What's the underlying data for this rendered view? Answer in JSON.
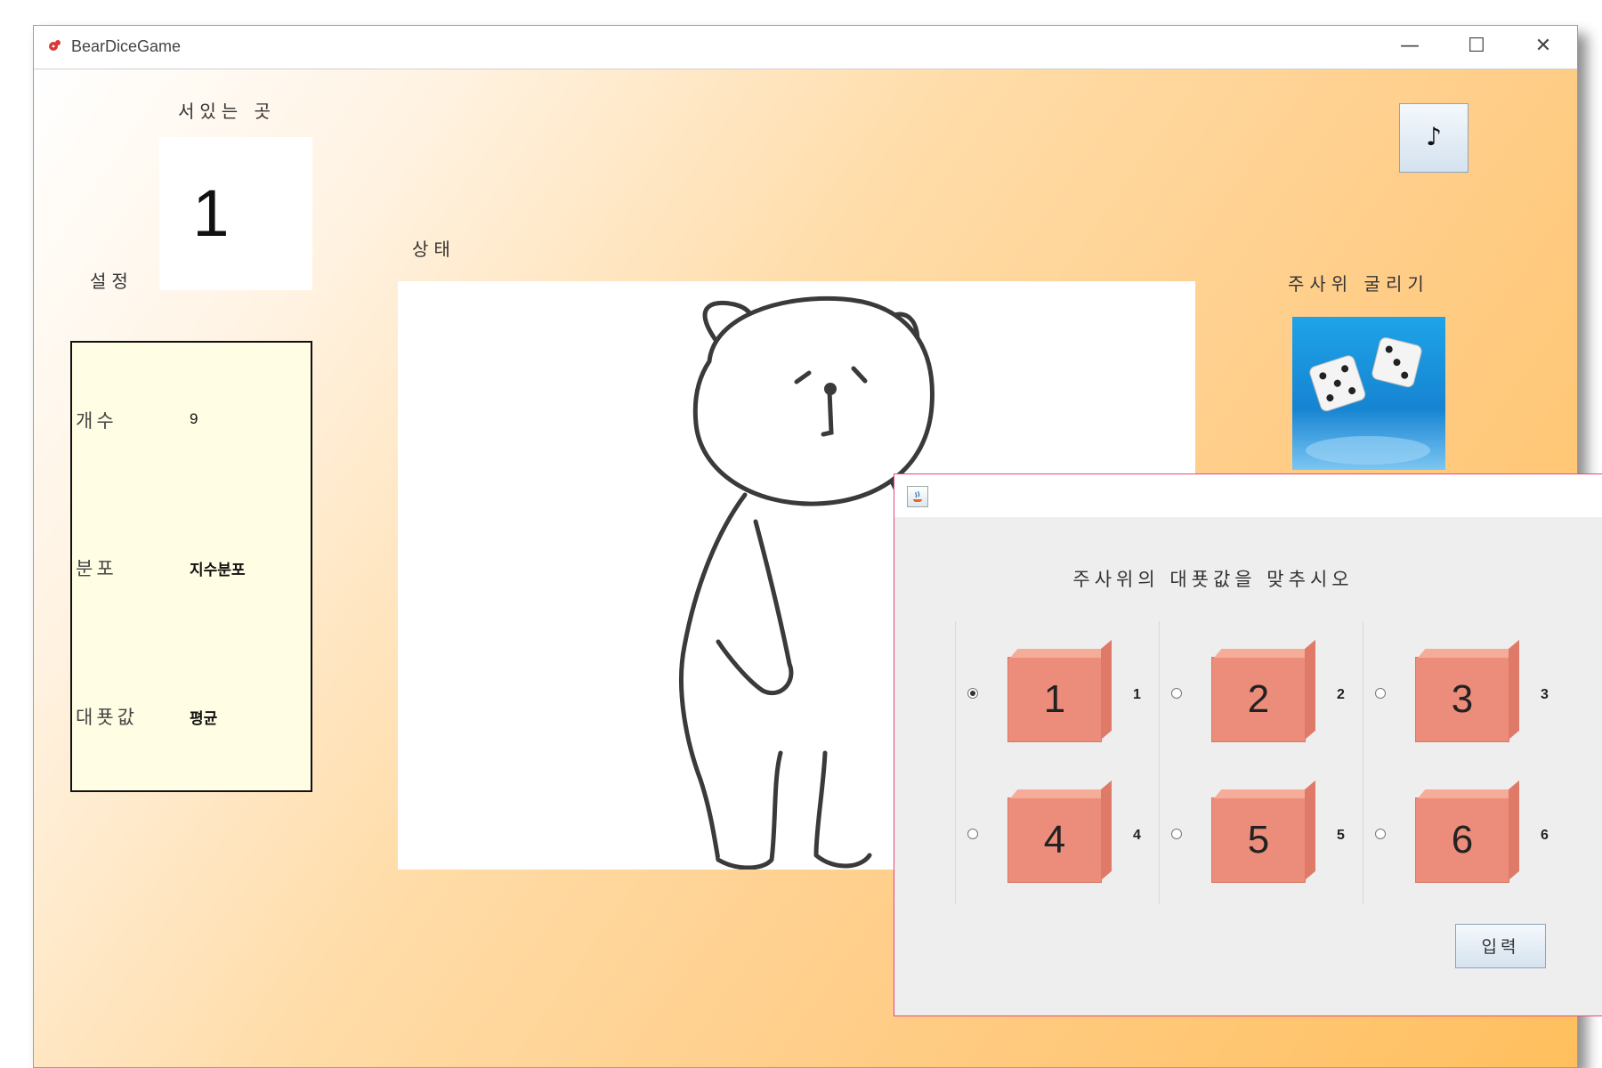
{
  "window": {
    "title": "BearDiceGame",
    "minimize_glyph": "—",
    "maximize_glyph": "☐",
    "close_glyph": "✕"
  },
  "position": {
    "label": "서있는 곳",
    "value": "1"
  },
  "settings": {
    "label": "설정",
    "rows": [
      {
        "key": "개수",
        "value": "9"
      },
      {
        "key": "분포",
        "value": "지수분포"
      },
      {
        "key": "대푯값",
        "value": "평균"
      }
    ]
  },
  "status": {
    "label": "상태"
  },
  "music_button": {
    "label": "♪"
  },
  "roll": {
    "label": "주사위 굴리기"
  },
  "dialog": {
    "heading": "주사위의 대푯값을 맞추시오",
    "options": [
      {
        "die": "1",
        "label": "1",
        "selected": true
      },
      {
        "die": "2",
        "label": "2",
        "selected": false
      },
      {
        "die": "3",
        "label": "3",
        "selected": false
      },
      {
        "die": "4",
        "label": "4",
        "selected": false
      },
      {
        "die": "5",
        "label": "5",
        "selected": false
      },
      {
        "die": "6",
        "label": "6",
        "selected": false
      }
    ],
    "submit_label": "입력"
  },
  "colors": {
    "accent_orange": "#ffbf5e",
    "die_face": "#ec8c7a",
    "settings_bg": "#fffde3",
    "dialog_border": "#e8467a"
  }
}
